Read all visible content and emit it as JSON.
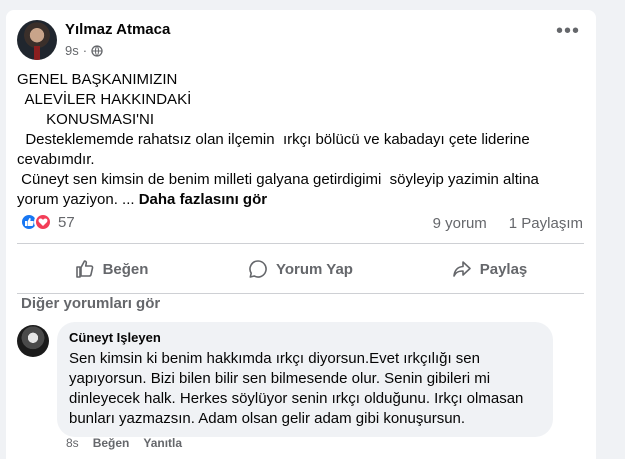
{
  "post": {
    "author": "Yılmaz Atmaca",
    "time": "9s",
    "more_icon": "•••",
    "lines": [
      "GENEL BAŞKANIMIZIN",
      "  ALEVİLER HAKKINDAKİ",
      "       KONUSMASI'NI",
      "  Desteklememde rahatsız olan ilçemin  ırkçı bölücü ve kabadayı çete liderine",
      "cevabımdır.",
      " Cüneyt sen kimsin de benim milleti galyana getirdigimi  söyleyip yazimin altina"
    ],
    "last_line": "yorum yaziyon. ... ",
    "see_more": "Daha fazlasını gör"
  },
  "reactions": {
    "count": "57",
    "icons": [
      "like-icon",
      "love-icon"
    ]
  },
  "stats": {
    "comments": "9 yorum",
    "shares": "1 Paylaşım"
  },
  "actions": {
    "like": "Beğen",
    "comment": "Yorum Yap",
    "share": "Paylaş"
  },
  "comments_section": {
    "more_label": "Diğer yorumları gör",
    "comment": {
      "author": "Cüneyt Işleyen",
      "lines": [
        "Sen kimsin ki benim hakkımda ırkçı diyorsun.Evet ırkçılığı sen",
        "yapıyorsun. Bizi bilen bilir sen bilmesende olur. Senin gibileri mi",
        "dinleyecek halk. Herkes söylüyor senin ırkçı olduğunu. Irkçı olmasan",
        "bunları yazmazsın. Adam olsan gelir adam gibi konuşursun."
      ],
      "time": "8s",
      "like": "Beğen",
      "reply": "Yanıtla"
    }
  },
  "colors": {
    "accent": "#1877f2",
    "love": "#f33e58",
    "muted": "#65676b"
  }
}
